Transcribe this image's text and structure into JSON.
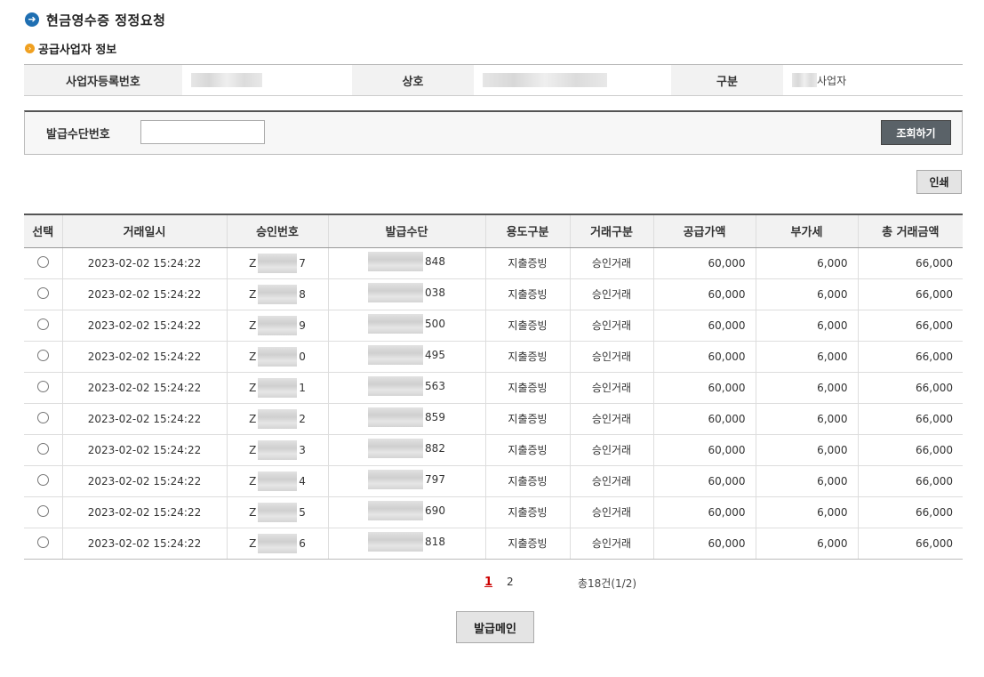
{
  "page": {
    "title": "현금영수증 정정요청",
    "section_title": "공급사업자 정보"
  },
  "supplier": {
    "reg_no_label": "사업자등록번호",
    "name_label": "상호",
    "type_label": "구분",
    "type_value": "사업자"
  },
  "search": {
    "label": "발급수단번호",
    "input_value": "",
    "button": "조회하기"
  },
  "print_button": "인쇄",
  "table": {
    "headers": [
      "선택",
      "거래일시",
      "승인번호",
      "발급수단",
      "용도구분",
      "거래구분",
      "공급가액",
      "부가세",
      "총 거래금액"
    ],
    "rows": [
      {
        "datetime": "2023-02-02 15:24:22",
        "approval_prefix": "Z",
        "approval_suffix": "7",
        "method_suffix": "848",
        "usage": "지출증빙",
        "trade": "승인거래",
        "supply": "60,000",
        "vat": "6,000",
        "total": "66,000"
      },
      {
        "datetime": "2023-02-02 15:24:22",
        "approval_prefix": "Z",
        "approval_suffix": "8",
        "method_suffix": "038",
        "usage": "지출증빙",
        "trade": "승인거래",
        "supply": "60,000",
        "vat": "6,000",
        "total": "66,000"
      },
      {
        "datetime": "2023-02-02 15:24:22",
        "approval_prefix": "Z",
        "approval_suffix": "9",
        "method_suffix": "500",
        "usage": "지출증빙",
        "trade": "승인거래",
        "supply": "60,000",
        "vat": "6,000",
        "total": "66,000"
      },
      {
        "datetime": "2023-02-02 15:24:22",
        "approval_prefix": "Z",
        "approval_suffix": "0",
        "method_suffix": "495",
        "usage": "지출증빙",
        "trade": "승인거래",
        "supply": "60,000",
        "vat": "6,000",
        "total": "66,000"
      },
      {
        "datetime": "2023-02-02 15:24:22",
        "approval_prefix": "Z",
        "approval_suffix": "1",
        "method_suffix": "563",
        "usage": "지출증빙",
        "trade": "승인거래",
        "supply": "60,000",
        "vat": "6,000",
        "total": "66,000"
      },
      {
        "datetime": "2023-02-02 15:24:22",
        "approval_prefix": "Z",
        "approval_suffix": "2",
        "method_suffix": "859",
        "usage": "지출증빙",
        "trade": "승인거래",
        "supply": "60,000",
        "vat": "6,000",
        "total": "66,000"
      },
      {
        "datetime": "2023-02-02 15:24:22",
        "approval_prefix": "Z",
        "approval_suffix": "3",
        "method_suffix": "882",
        "usage": "지출증빙",
        "trade": "승인거래",
        "supply": "60,000",
        "vat": "6,000",
        "total": "66,000"
      },
      {
        "datetime": "2023-02-02 15:24:22",
        "approval_prefix": "Z",
        "approval_suffix": "4",
        "method_suffix": "797",
        "usage": "지출증빙",
        "trade": "승인거래",
        "supply": "60,000",
        "vat": "6,000",
        "total": "66,000"
      },
      {
        "datetime": "2023-02-02 15:24:22",
        "approval_prefix": "Z",
        "approval_suffix": "5",
        "method_suffix": "690",
        "usage": "지출증빙",
        "trade": "승인거래",
        "supply": "60,000",
        "vat": "6,000",
        "total": "66,000"
      },
      {
        "datetime": "2023-02-02 15:24:22",
        "approval_prefix": "Z",
        "approval_suffix": "6",
        "method_suffix": "818",
        "usage": "지출증빙",
        "trade": "승인거래",
        "supply": "60,000",
        "vat": "6,000",
        "total": "66,000"
      }
    ]
  },
  "pagination": {
    "current": "1",
    "next": "2",
    "summary": "총18건(1/2)"
  },
  "main_button": "발급메인",
  "colors": {
    "title_icon": "#1f6fb2",
    "section_icon": "#f0a020",
    "search_button": "#5a6268",
    "current_page": "#cc0000"
  }
}
